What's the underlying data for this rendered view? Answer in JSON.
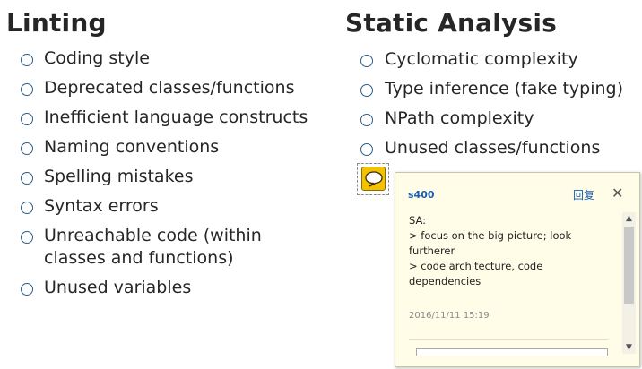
{
  "linting": {
    "heading": "Linting",
    "items": [
      {
        "line1": "Coding style",
        "line2": ""
      },
      {
        "line1": "Deprecated classes/functions",
        "line2": ""
      },
      {
        "line1": "Inefficient language constructs",
        "line2": ""
      },
      {
        "line1": "Naming conventions",
        "line2": ""
      },
      {
        "line1": "Spelling mistakes",
        "line2": ""
      },
      {
        "line1": "Syntax errors",
        "line2": ""
      },
      {
        "line1": "Unreachable code (within",
        "line2": "classes and functions)"
      },
      {
        "line1": "Unused variables",
        "line2": ""
      }
    ]
  },
  "static_analysis": {
    "heading": "Static Analysis",
    "items": [
      {
        "line1": "Cyclomatic complexity"
      },
      {
        "line1": "Type inference (fake typing)"
      },
      {
        "line1": "NPath complexity"
      },
      {
        "line1": "Unused classes/functions"
      }
    ]
  },
  "comment_icon": {
    "name": "speech-bubble-icon",
    "color": "#f2c200"
  },
  "popup": {
    "author": "s400",
    "reply_label": "回复",
    "close_label": "✕",
    "body_lines": [
      "SA:",
      "> focus on the big picture; look",
      "furtherer",
      "> code architecture, code",
      "dependencies"
    ],
    "date": "2016/11/11  15:19",
    "accent_color": "#1a5fb4"
  },
  "scrollbar": {
    "up_glyph": "▲",
    "down_glyph": "▼"
  }
}
